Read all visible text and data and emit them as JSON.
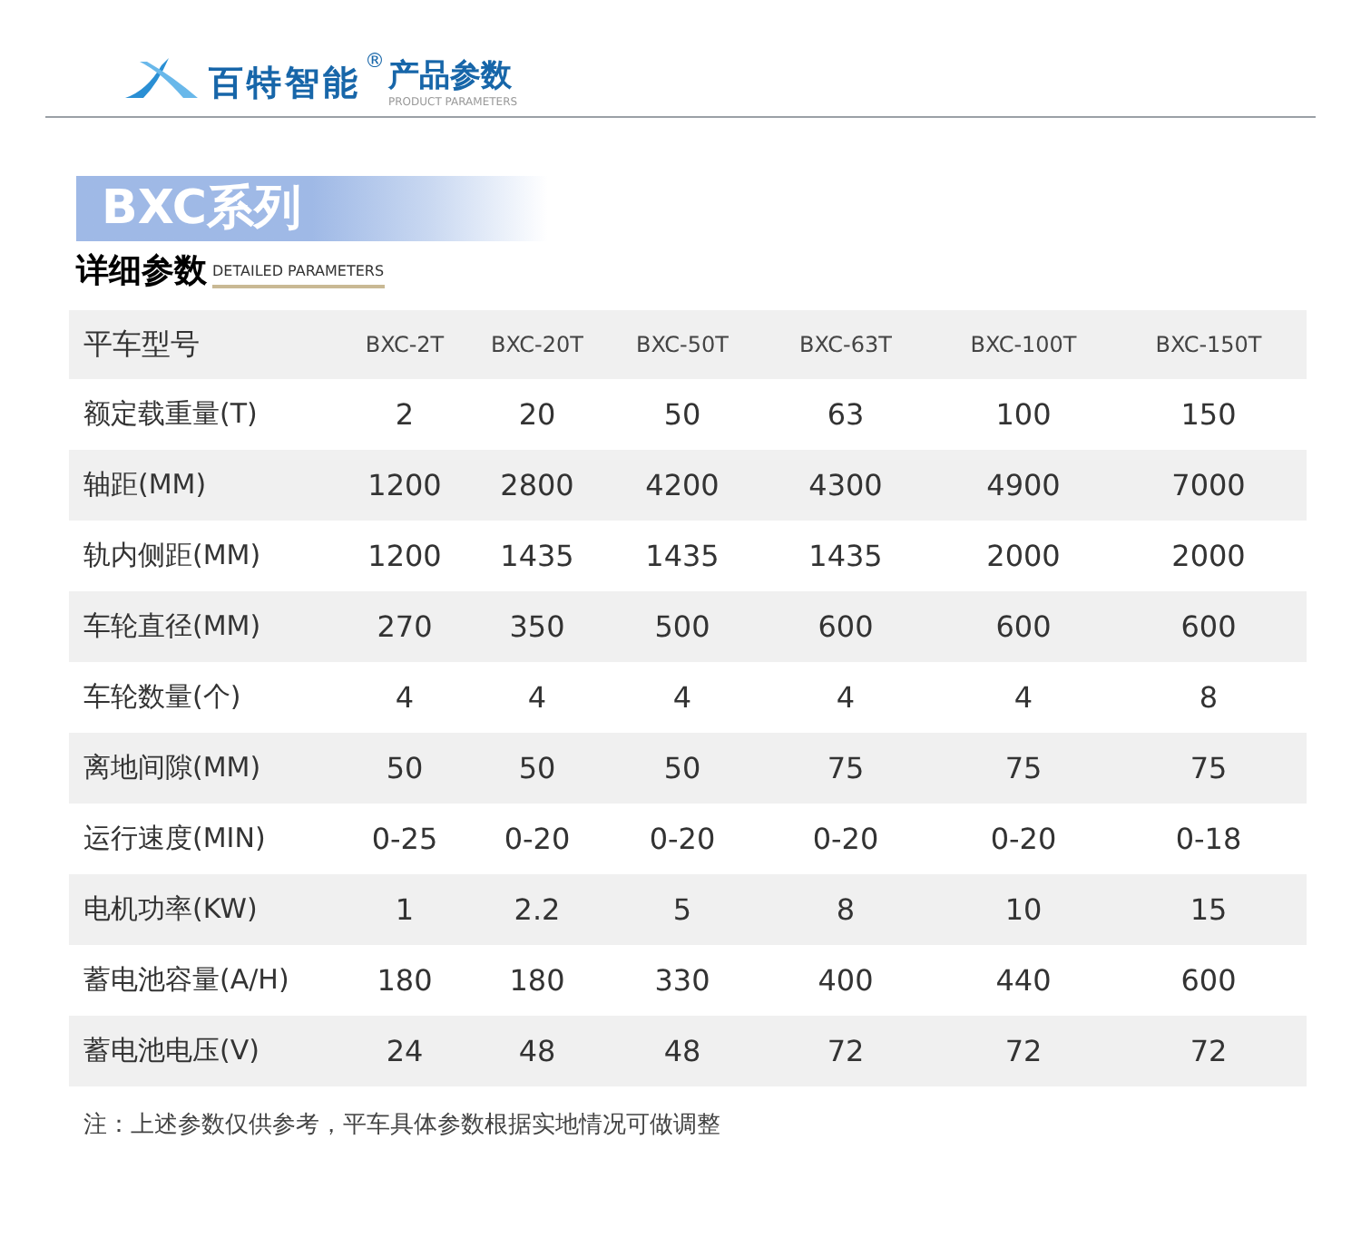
{
  "header": {
    "brand": "百特智能",
    "registered": "®",
    "title": "产品参数",
    "subtitle": "PRODUCT PARAMETERS"
  },
  "series_banner": {
    "title": "BXC系列"
  },
  "section": {
    "title": "详细参数",
    "subtitle": "DETAILED PARAMETERS"
  },
  "table": {
    "columns": [
      "平车型号",
      "BXC-2T",
      "BXC-20T",
      "BXC-50T",
      "BXC-63T",
      "BXC-100T",
      "BXC-150T"
    ],
    "rows": [
      [
        "额定载重量(T)",
        "2",
        "20",
        "50",
        "63",
        "100",
        "150"
      ],
      [
        "轴距(MM)",
        "1200",
        "2800",
        "4200",
        "4300",
        "4900",
        "7000"
      ],
      [
        "轨内侧距(MM)",
        "1200",
        "1435",
        "1435",
        "1435",
        "2000",
        "2000"
      ],
      [
        "车轮直径(MM)",
        "270",
        "350",
        "500",
        "600",
        "600",
        "600"
      ],
      [
        "车轮数量(个)",
        "4",
        "4",
        "4",
        "4",
        "4",
        "8"
      ],
      [
        "离地间隙(MM)",
        "50",
        "50",
        "50",
        "75",
        "75",
        "75"
      ],
      [
        "运行速度(MIN)",
        "0-25",
        "0-20",
        "0-20",
        "0-20",
        "0-20",
        "0-18"
      ],
      [
        "电机功率(KW)",
        "1",
        "2.2",
        "5",
        "8",
        "10",
        "15"
      ],
      [
        "蓄电池容量(A/H)",
        "180",
        "180",
        "330",
        "400",
        "440",
        "600"
      ],
      [
        "蓄电池电压(V)",
        "24",
        "48",
        "48",
        "72",
        "72",
        "72"
      ]
    ]
  },
  "note": "注：上述参数仅供参考，平车具体参数根据实地情况可做调整"
}
